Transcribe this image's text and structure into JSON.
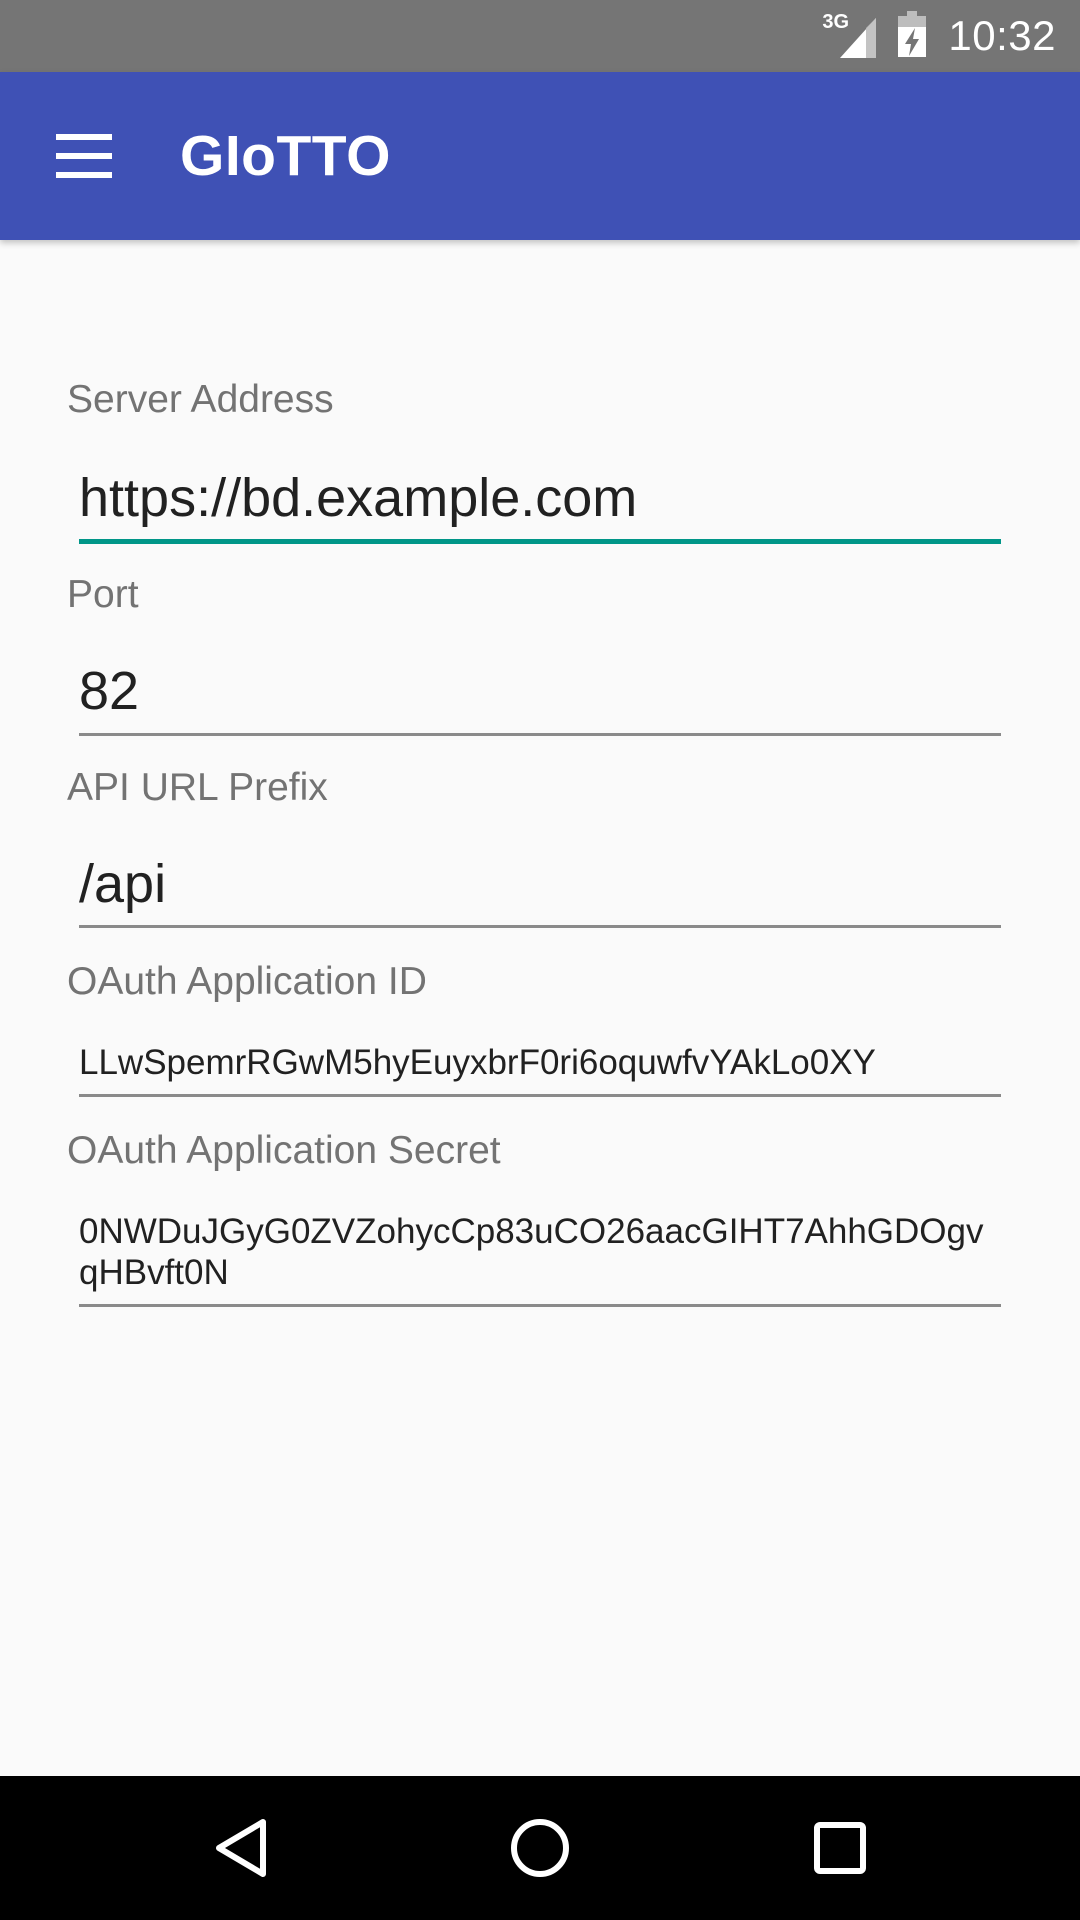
{
  "status_bar": {
    "network_type": "3G",
    "time": "10:32",
    "icons": [
      "signal-icon",
      "battery-charging-icon"
    ]
  },
  "app_bar": {
    "title": "GIoTTO",
    "menu_icon": "hamburger-menu-icon",
    "color": "#3f51b5"
  },
  "form": {
    "server_address": {
      "label": "Server Address",
      "value": "https://bd.example.com",
      "focused": true
    },
    "port": {
      "label": "Port",
      "value": "82"
    },
    "api_prefix": {
      "label": "API URL Prefix",
      "value": "/api"
    },
    "oauth_id": {
      "label": "OAuth Application ID",
      "value": "LLwSpemrRGwM5hyEuyxbrF0ri6oquwfvYAkLo0XY"
    },
    "oauth_secret": {
      "label": "OAuth Application Secret",
      "value": "0NWDuJGyG0ZVZohycCp83uCO26aacGIHT7AhhGDOgvqHBvft0N"
    },
    "accent_color": "#009688"
  },
  "nav_bar": {
    "buttons": [
      "back-icon",
      "home-icon",
      "recents-icon"
    ]
  }
}
